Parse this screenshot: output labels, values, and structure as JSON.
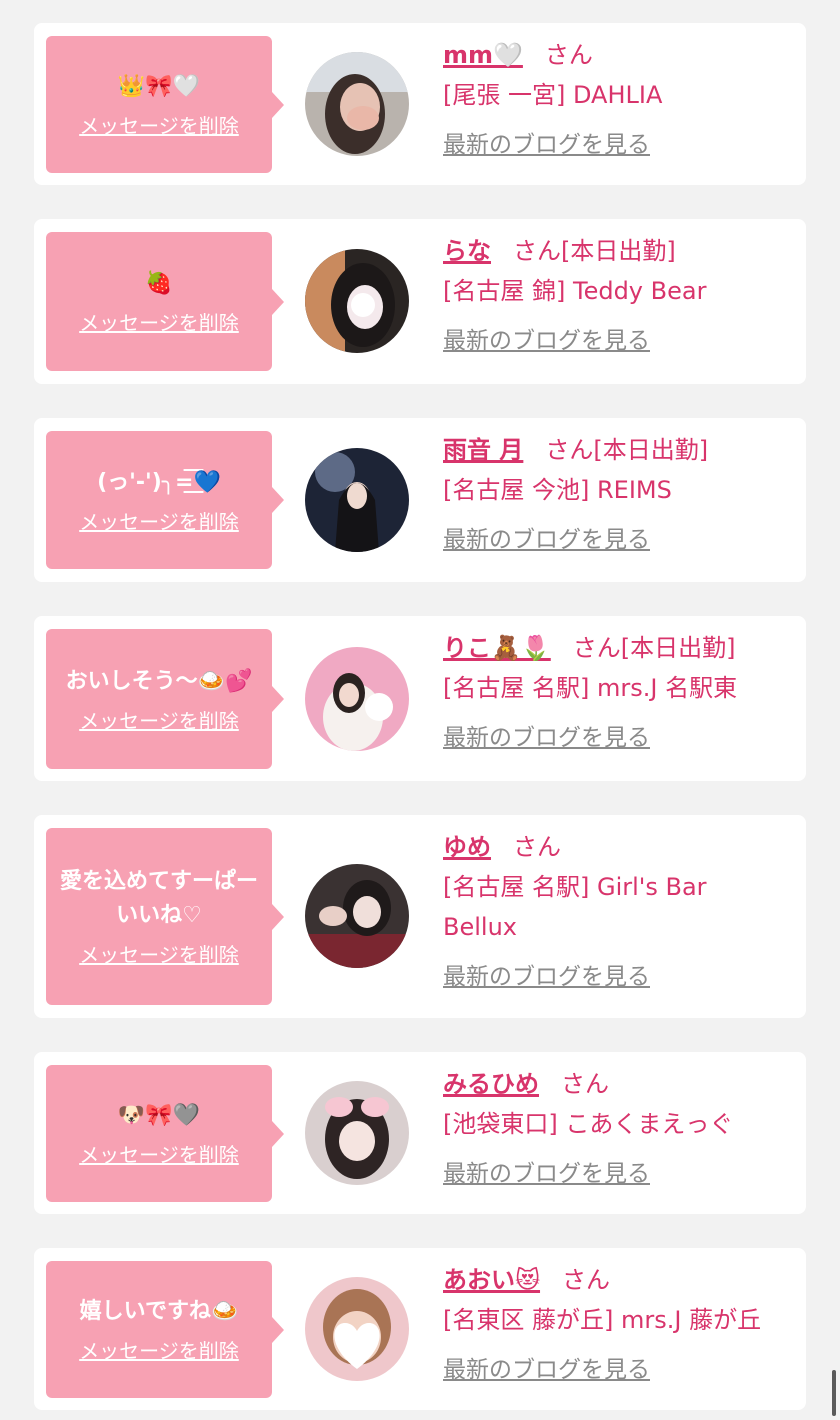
{
  "colors": {
    "background": "#f2f2f2",
    "card": "#ffffff",
    "bubble": "#f7a1b3",
    "accent": "#d8346b",
    "link_gray": "#8a8a8a"
  },
  "delete_label": "メッセージを削除",
  "blog_label": "最新のブログを見る",
  "messages": [
    {
      "message": "👑🎀🤍",
      "name": "mm🤍",
      "honorific": "さん",
      "status": "",
      "shop": "[尾張 一宮] DAHLIA",
      "avatar_icon": "face-photo-avatar"
    },
    {
      "message": "🍓",
      "name": "らな",
      "honorific": "さん",
      "status": "[本日出勤]",
      "shop": "[名古屋 錦] Teddy Bear",
      "avatar_icon": "face-photo-avatar"
    },
    {
      "message": "(っ'-')╮=͟͟͞͞💙",
      "name": "雨音 月",
      "honorific": "さん",
      "status": "[本日出勤]",
      "shop": "[名古屋 今池] REIMS",
      "avatar_icon": "face-photo-avatar"
    },
    {
      "message": "おいしそう〜🍛💕",
      "name": "りこ🧸🌷",
      "honorific": "さん",
      "status": "[本日出勤]",
      "shop": "[名古屋 名駅] mrs.J 名駅東",
      "avatar_icon": "face-photo-avatar"
    },
    {
      "message": "愛を込めてすーぱーいいね♡",
      "name": "ゆめ",
      "honorific": "さん",
      "status": "",
      "shop": "[名古屋 名駅] Girl's Bar Bellux",
      "avatar_icon": "face-photo-avatar"
    },
    {
      "message": "🐶🎀🩶",
      "name": "みるひめ",
      "honorific": "さん",
      "status": "",
      "shop": "[池袋東口] こあくまえっぐ",
      "avatar_icon": "face-photo-avatar"
    },
    {
      "message": "嬉しいですね🍛",
      "name": "あおい😻",
      "honorific": "さん",
      "status": "",
      "shop": "[名東区 藤が丘] mrs.J 藤が丘",
      "avatar_icon": "face-photo-avatar"
    }
  ]
}
